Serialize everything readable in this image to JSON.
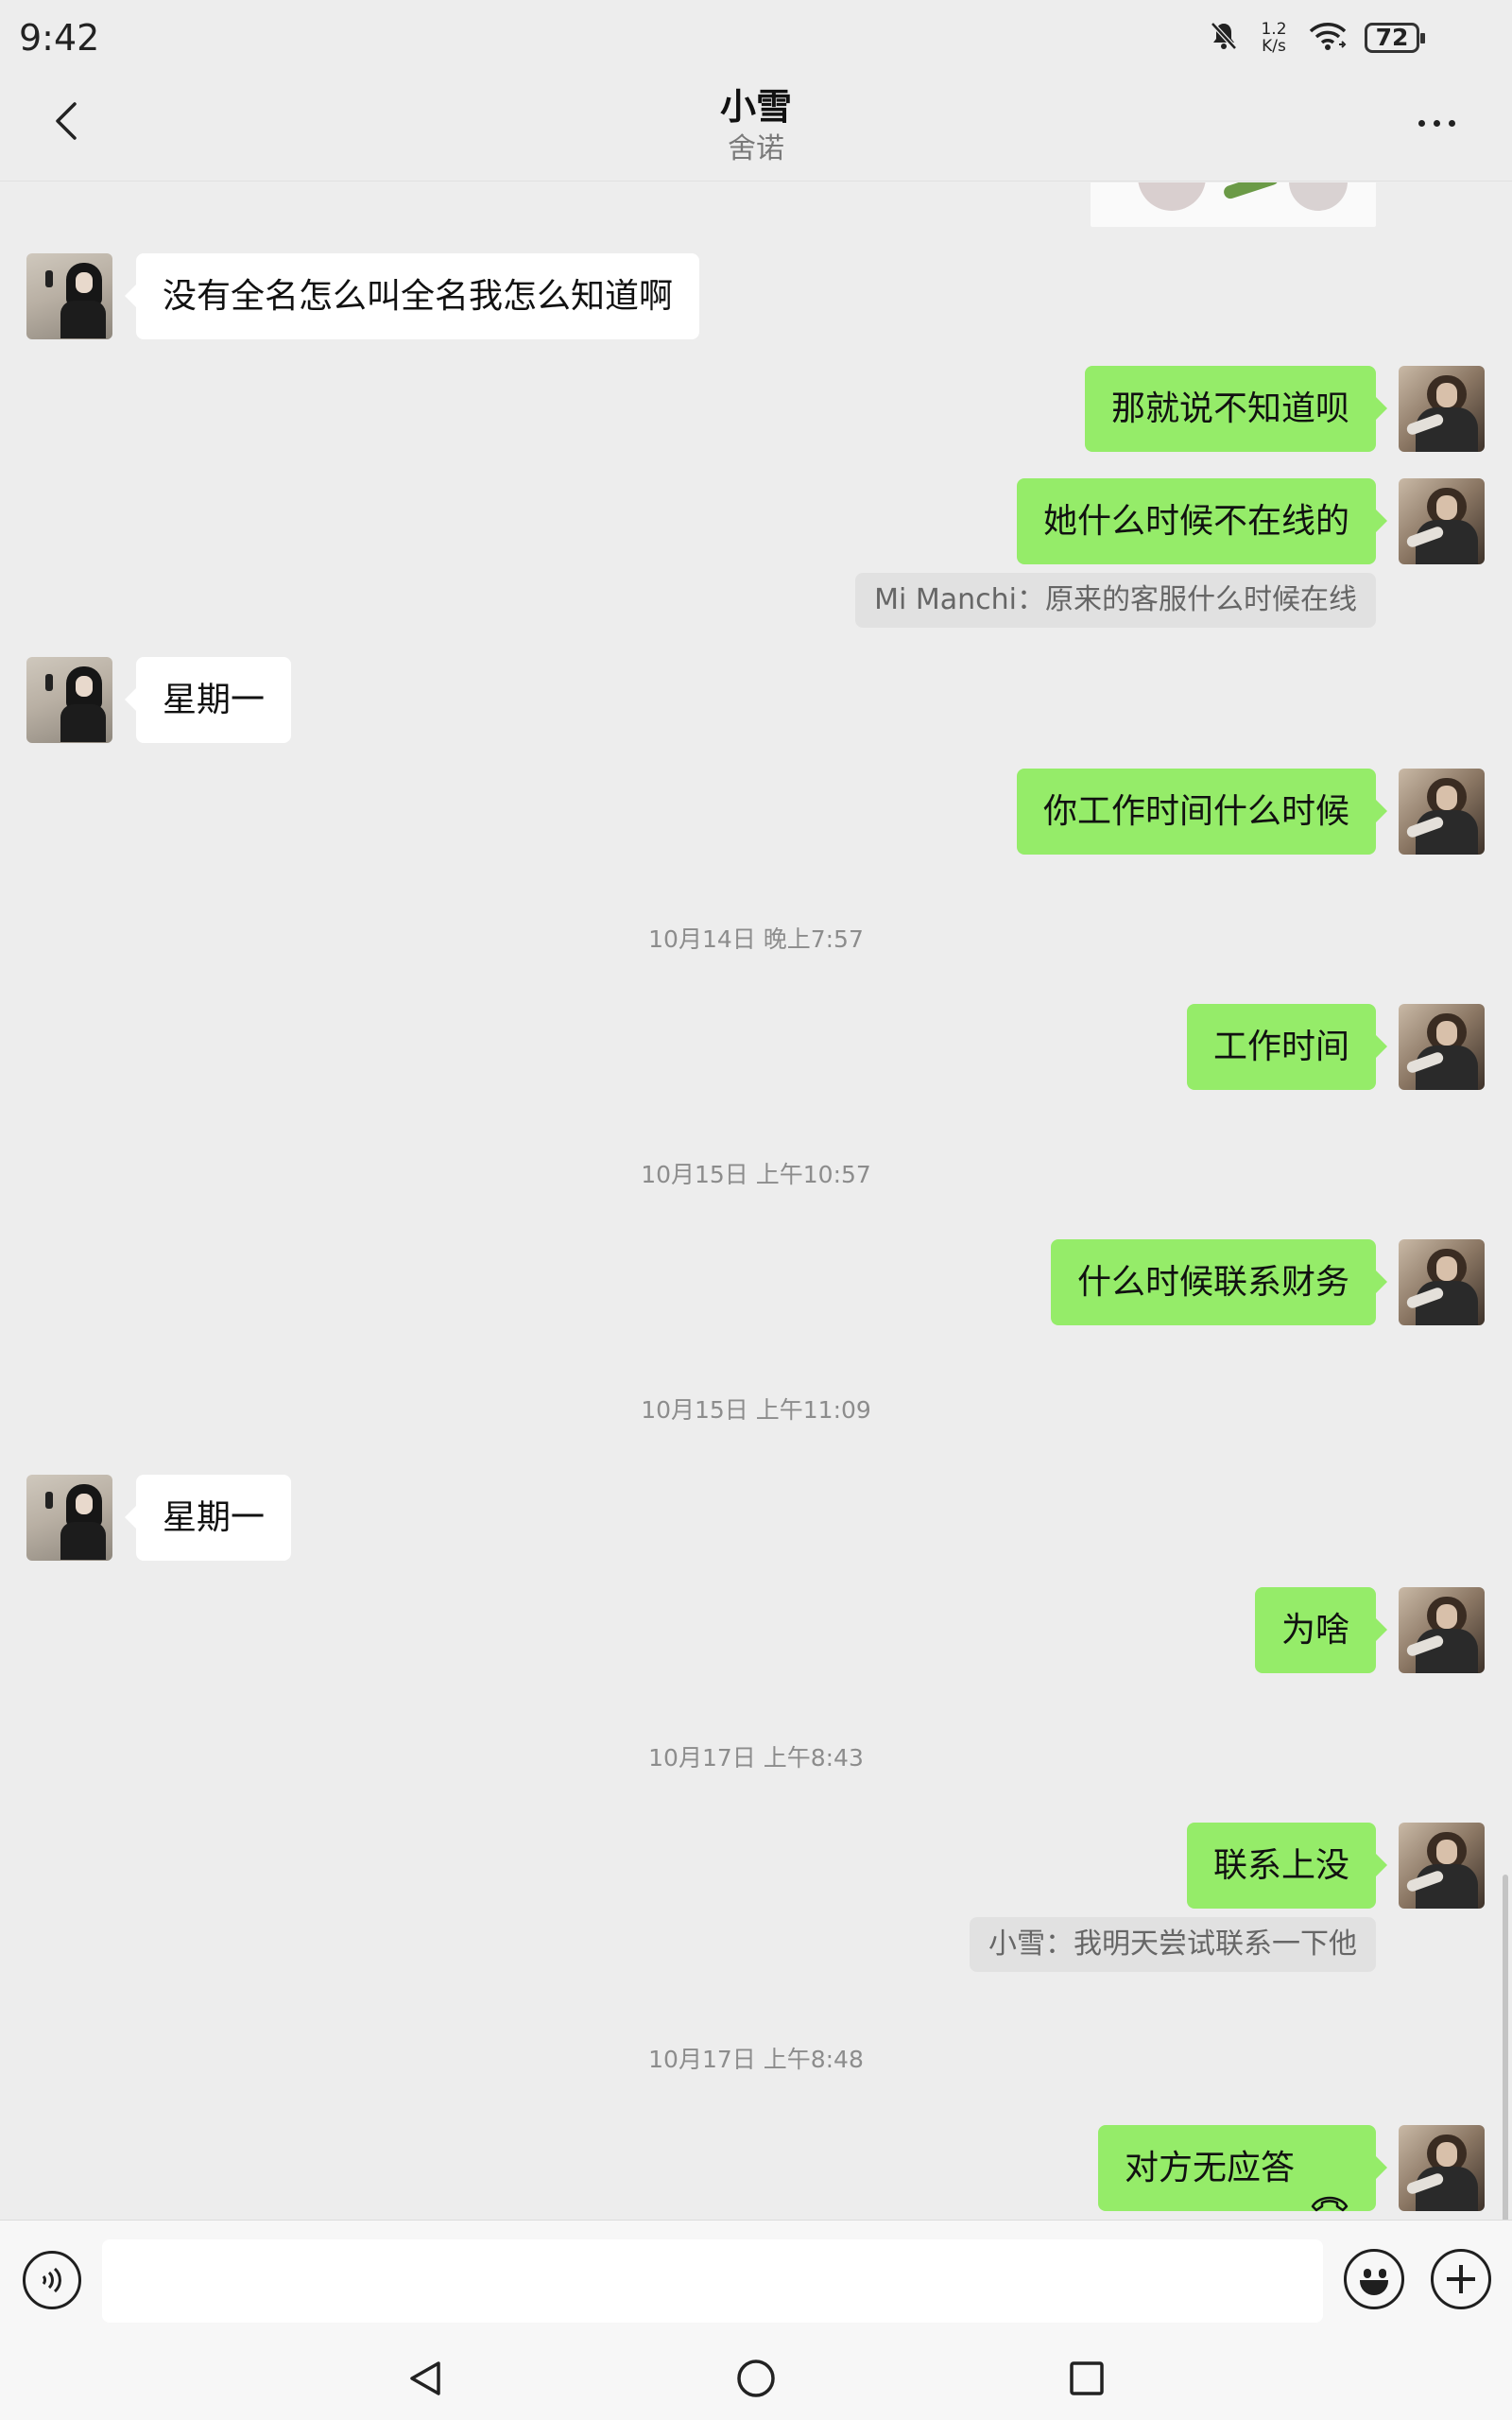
{
  "status_bar": {
    "time": "9:42",
    "net_speed_value": "1.2",
    "net_speed_unit": "K/s",
    "battery": "72",
    "icons": [
      "bell-muted-icon",
      "wifi-icon",
      "battery-icon"
    ]
  },
  "header": {
    "title": "小雪",
    "subtitle": "舍诺",
    "back_icon": "chevron-left-icon",
    "more_icon": "more-dots-icon"
  },
  "messages": [
    {
      "side": "left",
      "text": "没有全名怎么叫全名我怎么知道啊"
    },
    {
      "side": "right",
      "text": "那就说不知道呗"
    },
    {
      "side": "right",
      "text": "她什么时候不在线的",
      "quote": "Mi Manchi：原来的客服什么时候在线"
    },
    {
      "side": "left",
      "text": "星期一"
    },
    {
      "side": "right",
      "text": "你工作时间什么时候"
    },
    {
      "timestamp": "10月14日 晚上7:57"
    },
    {
      "side": "right",
      "text": "工作时间"
    },
    {
      "timestamp": "10月15日 上午10:57"
    },
    {
      "side": "right",
      "text": "什么时候联系财务"
    },
    {
      "timestamp": "10月15日 上午11:09"
    },
    {
      "side": "left",
      "text": "星期一"
    },
    {
      "side": "right",
      "text": "为啥"
    },
    {
      "timestamp": "10月17日 上午8:43"
    },
    {
      "side": "right",
      "text": "联系上没",
      "quote": "小雪：我明天尝试联系一下他"
    },
    {
      "timestamp": "10月17日 上午8:48"
    },
    {
      "side": "right",
      "text": "对方无应答",
      "icon": "call-hangup-icon"
    }
  ],
  "input_bar": {
    "voice_icon": "voice-icon",
    "input_value": "",
    "emoji_icon": "emoji-icon",
    "plus_icon": "plus-icon"
  },
  "nav_bar": {
    "icons": [
      "nav-back-icon",
      "nav-home-icon",
      "nav-recents-icon"
    ]
  },
  "colors": {
    "background": "#ededed",
    "outgoing_bubble": "#95ec69",
    "incoming_bubble": "#ffffff",
    "quote_background": "#e1e1e1",
    "timestamp_text": "#8c8c8c"
  }
}
